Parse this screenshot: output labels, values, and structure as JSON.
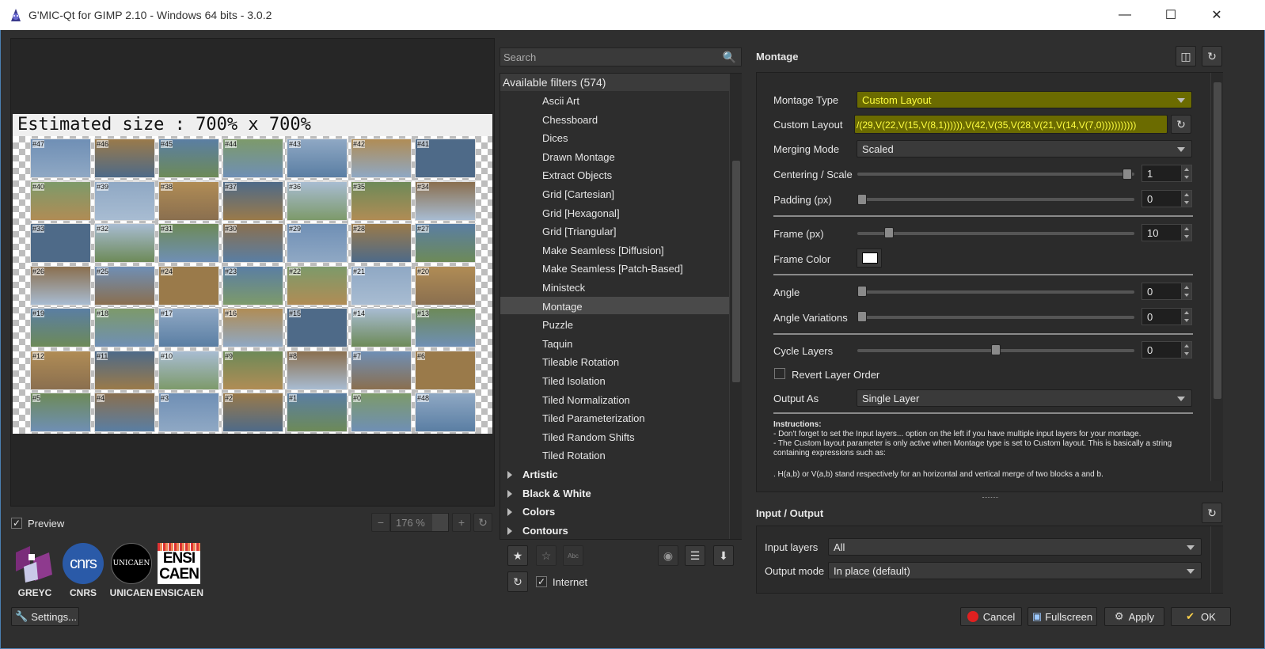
{
  "window": {
    "title": "G'MIC-Qt for GIMP 2.10 - Windows 64 bits - 3.0.2",
    "minimize_icon": "minimize-icon",
    "maximize_icon": "maximize-icon",
    "close_icon": "close-icon"
  },
  "preview": {
    "estimated_size": "Estimated size :  700% x 700%",
    "thumb_labels": [
      "#47",
      "#46",
      "#45",
      "#44",
      "#43",
      "#42",
      "#41",
      "#40",
      "#39",
      "#38",
      "#37",
      "#36",
      "#35",
      "#34",
      "#33",
      "#32",
      "#31",
      "#30",
      "#29",
      "#28",
      "#27",
      "#26",
      "#25",
      "#24",
      "#23",
      "#22",
      "#21",
      "#20",
      "#19",
      "#18",
      "#17",
      "#16",
      "#15",
      "#14",
      "#13",
      "#12",
      "#11",
      "#10",
      "#9",
      "#8",
      "#7",
      "#6",
      "#5",
      "#4",
      "#3",
      "#2",
      "#1",
      "#0",
      "#48"
    ],
    "checkbox_label": "Preview",
    "checked": true,
    "zoom_value": "176 %"
  },
  "logos": [
    {
      "name": "GREYC"
    },
    {
      "name": "CNRS",
      "text": "cnrs"
    },
    {
      "name": "UNICAEN",
      "text": "UNICAEN"
    },
    {
      "name": "ENSICAEN",
      "text_top": "ENSI",
      "text_bottom": "CAEN"
    }
  ],
  "settings_button": "Settings...",
  "filters": {
    "search_placeholder": "Search",
    "header": "Available filters (574)",
    "items": [
      "Ascii Art",
      "Chessboard",
      "Dices",
      "Drawn Montage",
      "Extract Objects",
      "Grid [Cartesian]",
      "Grid [Hexagonal]",
      "Grid [Triangular]",
      "Make Seamless [Diffusion]",
      "Make Seamless [Patch-Based]",
      "Ministeck",
      "Montage",
      "Puzzle",
      "Taquin",
      "Tileable Rotation",
      "Tiled Isolation",
      "Tiled Normalization",
      "Tiled Parameterization",
      "Tiled Random Shifts",
      "Tiled Rotation"
    ],
    "selected": "Montage",
    "categories": [
      "Artistic",
      "Black & White",
      "Colors",
      "Contours"
    ],
    "internet_label": "Internet",
    "internet_checked": true
  },
  "params": {
    "title": "Montage",
    "montage_type_label": "Montage Type",
    "montage_type_value": "Custom Layout",
    "custom_layout_label": "Custom Layout",
    "custom_layout_value": "/(29,V(22,V(15,V(8,1)))))),V(42,V(35,V(28,V(21,V(14,V(7,0)))))))))))",
    "merging_mode_label": "Merging Mode",
    "merging_mode_value": "Scaled",
    "centering_label": "Centering / Scale",
    "centering_value": "1",
    "centering_fraction": 0.99,
    "padding_label": "Padding (px)",
    "padding_value": "0",
    "padding_fraction": 0,
    "frame_label": "Frame (px)",
    "frame_value": "10",
    "frame_fraction": 0.1,
    "frame_color_label": "Frame Color",
    "frame_color": "#ffffff",
    "angle_label": "Angle",
    "angle_value": "0",
    "angle_fraction": 0,
    "angle_var_label": "Angle Variations",
    "angle_var_value": "0",
    "angle_var_fraction": 0,
    "cycle_label": "Cycle Layers",
    "cycle_value": "0",
    "cycle_fraction": 0.5,
    "revert_label": "Revert Layer Order",
    "output_as_label": "Output As",
    "output_as_value": "Single Layer",
    "instructions_title": "Instructions:",
    "instr_line1": "- Don't forget to set the Input layers... option on the left if you have multiple input layers for your montage.",
    "instr_line2": "- The Custom layout parameter is only active when Montage type is set to Custom layout. This is basically a string",
    "instr_line3": "containing expressions such as:",
    "instr_line4": ". H(a,b) or V(a,b) stand respectively for an horizontal and vertical merge of two blocks a and b."
  },
  "io": {
    "title": "Input / Output",
    "input_layers_label": "Input layers",
    "input_layers_value": "All",
    "output_mode_label": "Output mode",
    "output_mode_value": "In place (default)"
  },
  "buttons": {
    "cancel": "Cancel",
    "fullscreen": "Fullscreen",
    "apply": "Apply",
    "ok": "OK"
  },
  "colors": {
    "highlight_bg": "#6b6b00",
    "highlight_text": "#ffff40",
    "selected_row": "#4a4a4a"
  }
}
